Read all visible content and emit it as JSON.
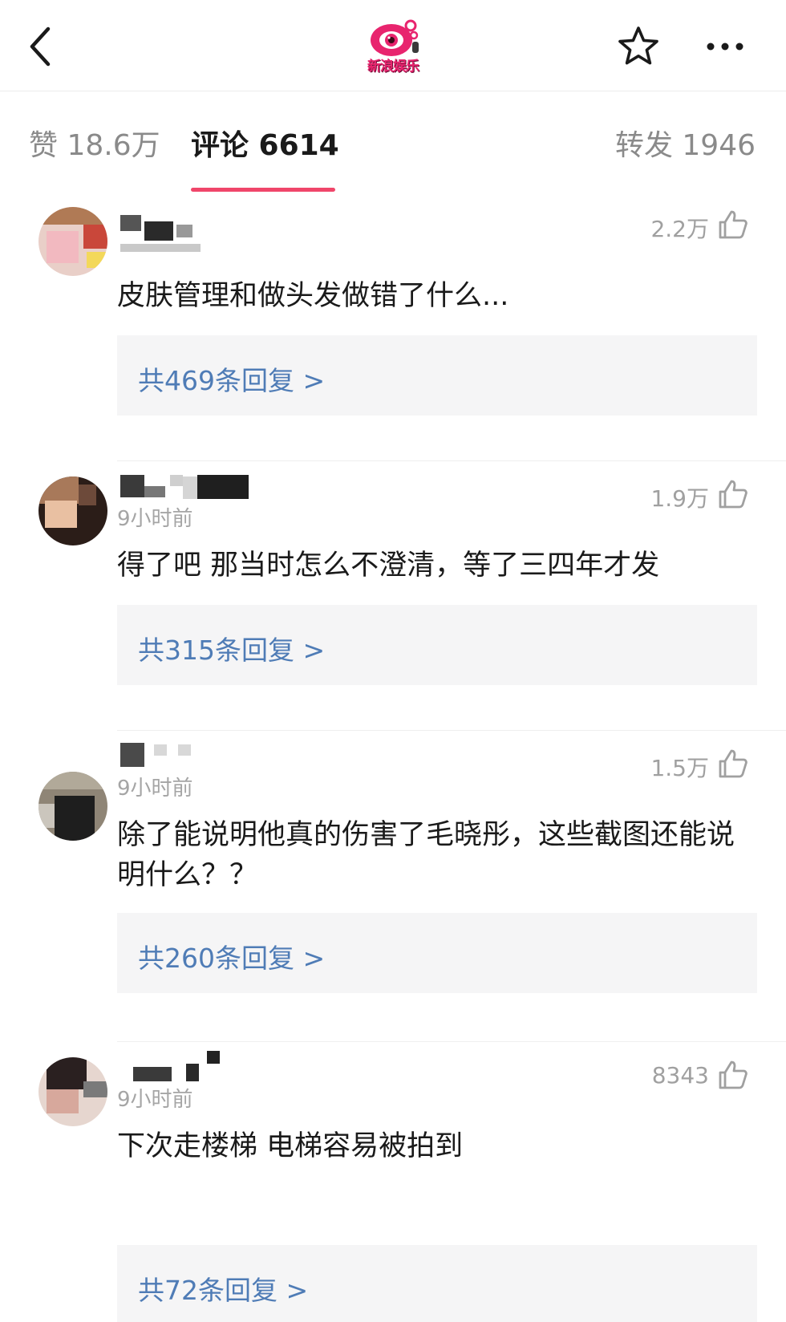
{
  "header": {
    "back_icon": "chevron-left-icon",
    "logo_text": "新浪娱乐",
    "favorite_icon": "star-outline-icon",
    "more_icon": "more-horizontal-icon"
  },
  "tabs": {
    "likes": "赞 18.6万",
    "comments": "评论 6614",
    "reposts": "转发 1946",
    "active_color": "#f0466a"
  },
  "comments": [
    {
      "time": "",
      "likes": "2.2万",
      "text": "皮肤管理和做头发做错了什么...",
      "replies": "共469条回复 >"
    },
    {
      "time": "9小时前",
      "likes": "1.9万",
      "text": "得了吧 那当时怎么不澄清，等了三四年才发",
      "replies": "共315条回复 >"
    },
    {
      "time": "9小时前",
      "likes": "1.5万",
      "text": "除了能说明他真的伤害了毛晓彤，这些截图还能说明什么？？",
      "replies": "共260条回复 >"
    },
    {
      "time": "9小时前",
      "likes": "8343",
      "text": "下次走楼梯 电梯容易被拍到",
      "replies": "共72条回复 >"
    }
  ],
  "colors": {
    "reply_link": "#4f7cb6",
    "reply_bg": "#f5f5f6",
    "muted_text": "#a5a5a5"
  }
}
